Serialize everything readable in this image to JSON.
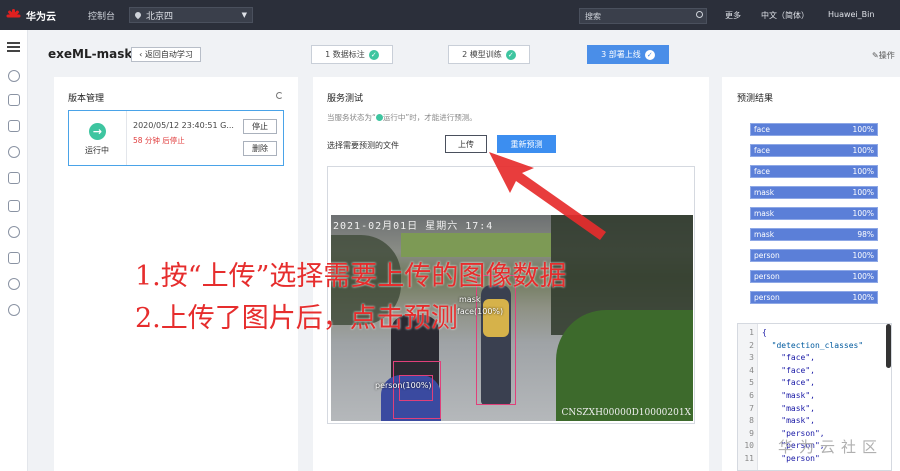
{
  "topbar": {
    "brand": "华为云",
    "logo_text": "HUAWEI",
    "console": "控制台",
    "region": "北京四",
    "search_placeholder": "搜索",
    "more": "更多",
    "language": "中文（简体）",
    "user": "Huawei_Bin"
  },
  "page": {
    "title": "exeML-mask",
    "back_label": "返回自动学习",
    "op_guide": "操作",
    "steps": [
      {
        "label": "1 数据标注"
      },
      {
        "label": "2 模型训练"
      },
      {
        "label": "3 部署上线"
      }
    ]
  },
  "version_panel": {
    "title": "版本管理",
    "status": "运行中",
    "time": "2020/05/12 23:40:51 G...",
    "remaining": "58 分钟 后停止",
    "stop": "停止",
    "delete": "删除"
  },
  "service_panel": {
    "title": "服务测试",
    "hint_prefix": "当服务状态为“",
    "hint_status": "运行中",
    "hint_suffix": "”时，才能进行预测。",
    "choose_label": "选择需要预测的文件",
    "upload": "上传",
    "repredict": "重新预测",
    "image": {
      "timestamp": "2021-02月01日 星期六 17:4",
      "serial": "CNSZXH00000D10000201X",
      "labels": [
        "mask",
        "face(100%)",
        "person(100%)"
      ]
    }
  },
  "result_panel": {
    "title": "预测结果",
    "items": [
      {
        "name": "face",
        "pct": "100%"
      },
      {
        "name": "face",
        "pct": "100%"
      },
      {
        "name": "face",
        "pct": "100%"
      },
      {
        "name": "mask",
        "pct": "100%"
      },
      {
        "name": "mask",
        "pct": "100%"
      },
      {
        "name": "mask",
        "pct": "98%"
      },
      {
        "name": "person",
        "pct": "100%"
      },
      {
        "name": "person",
        "pct": "100%"
      },
      {
        "name": "person",
        "pct": "100%"
      }
    ],
    "json_lines": [
      {
        "n": "1",
        "code": "{"
      },
      {
        "n": "2",
        "code": "  \"detection_classes\""
      },
      {
        "n": "3",
        "code": "    \"face\","
      },
      {
        "n": "4",
        "code": "    \"face\","
      },
      {
        "n": "5",
        "code": "    \"face\","
      },
      {
        "n": "6",
        "code": "    \"mask\","
      },
      {
        "n": "7",
        "code": "    \"mask\","
      },
      {
        "n": "8",
        "code": "    \"mask\","
      },
      {
        "n": "9",
        "code": "    \"person\","
      },
      {
        "n": "10",
        "code": "    \"person\","
      },
      {
        "n": "11",
        "code": "    \"person\""
      }
    ]
  },
  "annotation": {
    "line1": "1.按“上传”选择需要上传的图像数据",
    "line2": "2.上传了图片后，点击预测"
  },
  "watermark": "华为云社区"
}
